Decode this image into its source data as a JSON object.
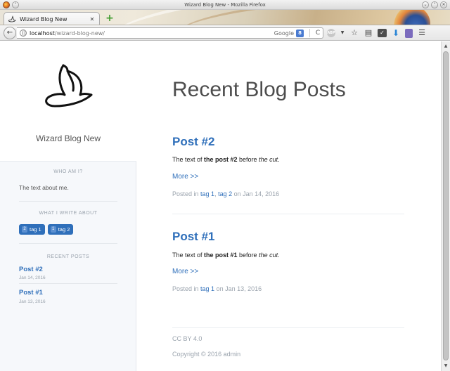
{
  "window": {
    "title": "Wizard Blog New - Mozilla Firefox"
  },
  "tab": {
    "title": "Wizard Blog New",
    "close_glyph": "✕"
  },
  "nav": {
    "url_host": "localhost",
    "url_path": "/wizard-blog-new/",
    "search_engine": "Google",
    "search_icon_letter": "8",
    "back_glyph": "←",
    "reload_glyph": "C"
  },
  "sidebar": {
    "site_title": "Wizard Blog New",
    "about": {
      "heading": "WHO AM I?",
      "text": "The text about me."
    },
    "topics": {
      "heading": "WHAT I WRITE ABOUT",
      "tags": [
        {
          "count": "2",
          "label": "tag 1"
        },
        {
          "count": "1",
          "label": "tag 2"
        }
      ]
    },
    "recent": {
      "heading": "RECENT POSTS",
      "posts": [
        {
          "title": "Post #2",
          "date": "Jan 14, 2016"
        },
        {
          "title": "Post #1",
          "date": "Jan 13, 2016"
        }
      ]
    }
  },
  "main": {
    "page_title": "Recent Blog Posts",
    "posts": [
      {
        "title": "Post #2",
        "excerpt_a": "The text of ",
        "excerpt_bold": "the post #2",
        "excerpt_b": " before ",
        "excerpt_italic": "the cut",
        "excerpt_c": ".",
        "more": "More >>",
        "meta_prefix": "Posted in ",
        "tags": [
          "tag 1",
          "tag 2"
        ],
        "tag_sep": ", ",
        "meta_suffix": " on Jan 14, 2016"
      },
      {
        "title": "Post #1",
        "excerpt_a": "The text of ",
        "excerpt_bold": "the post #1",
        "excerpt_b": " before ",
        "excerpt_italic": "the cut",
        "excerpt_c": ".",
        "more": "More >>",
        "meta_prefix": "Posted in ",
        "tags": [
          "tag 1"
        ],
        "meta_suffix": " on Jan 13, 2016"
      }
    ],
    "footer": {
      "license": "CC BY 4.0",
      "copyright": "Copyright © 2016 admin"
    }
  },
  "colors": {
    "link": "#2f6fba",
    "muted": "#9aa3ad",
    "sidebar_bg": "#f6f8fb"
  }
}
